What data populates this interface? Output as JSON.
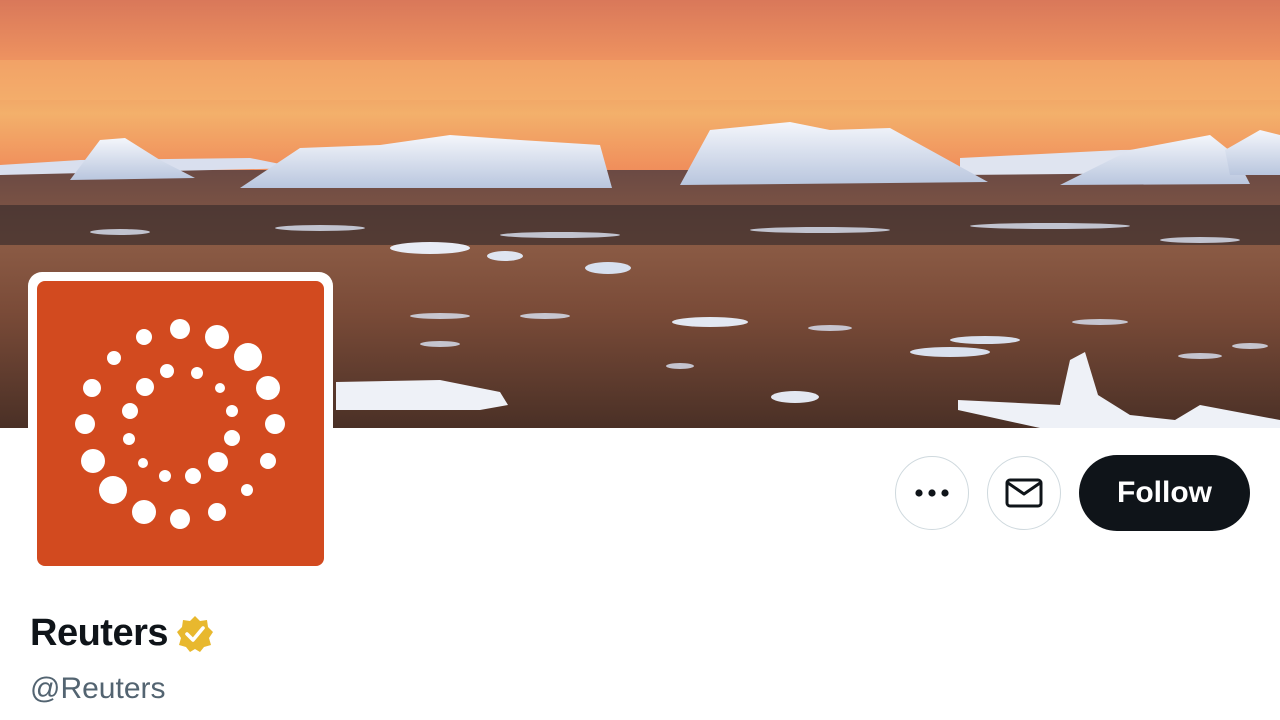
{
  "profile": {
    "display_name": "Reuters",
    "handle": "@Reuters",
    "verified": true,
    "verified_badge_color": "#e8b82e",
    "avatar_background": "#d24a1f",
    "avatar_icon": "reuters-dot-logo-icon"
  },
  "banner": {
    "description_icon": "icebergs-sunset-banner"
  },
  "actions": {
    "more_icon": "more-icon",
    "message_icon": "envelope-icon",
    "follow_label": "Follow",
    "follow_background": "#0f1419"
  }
}
